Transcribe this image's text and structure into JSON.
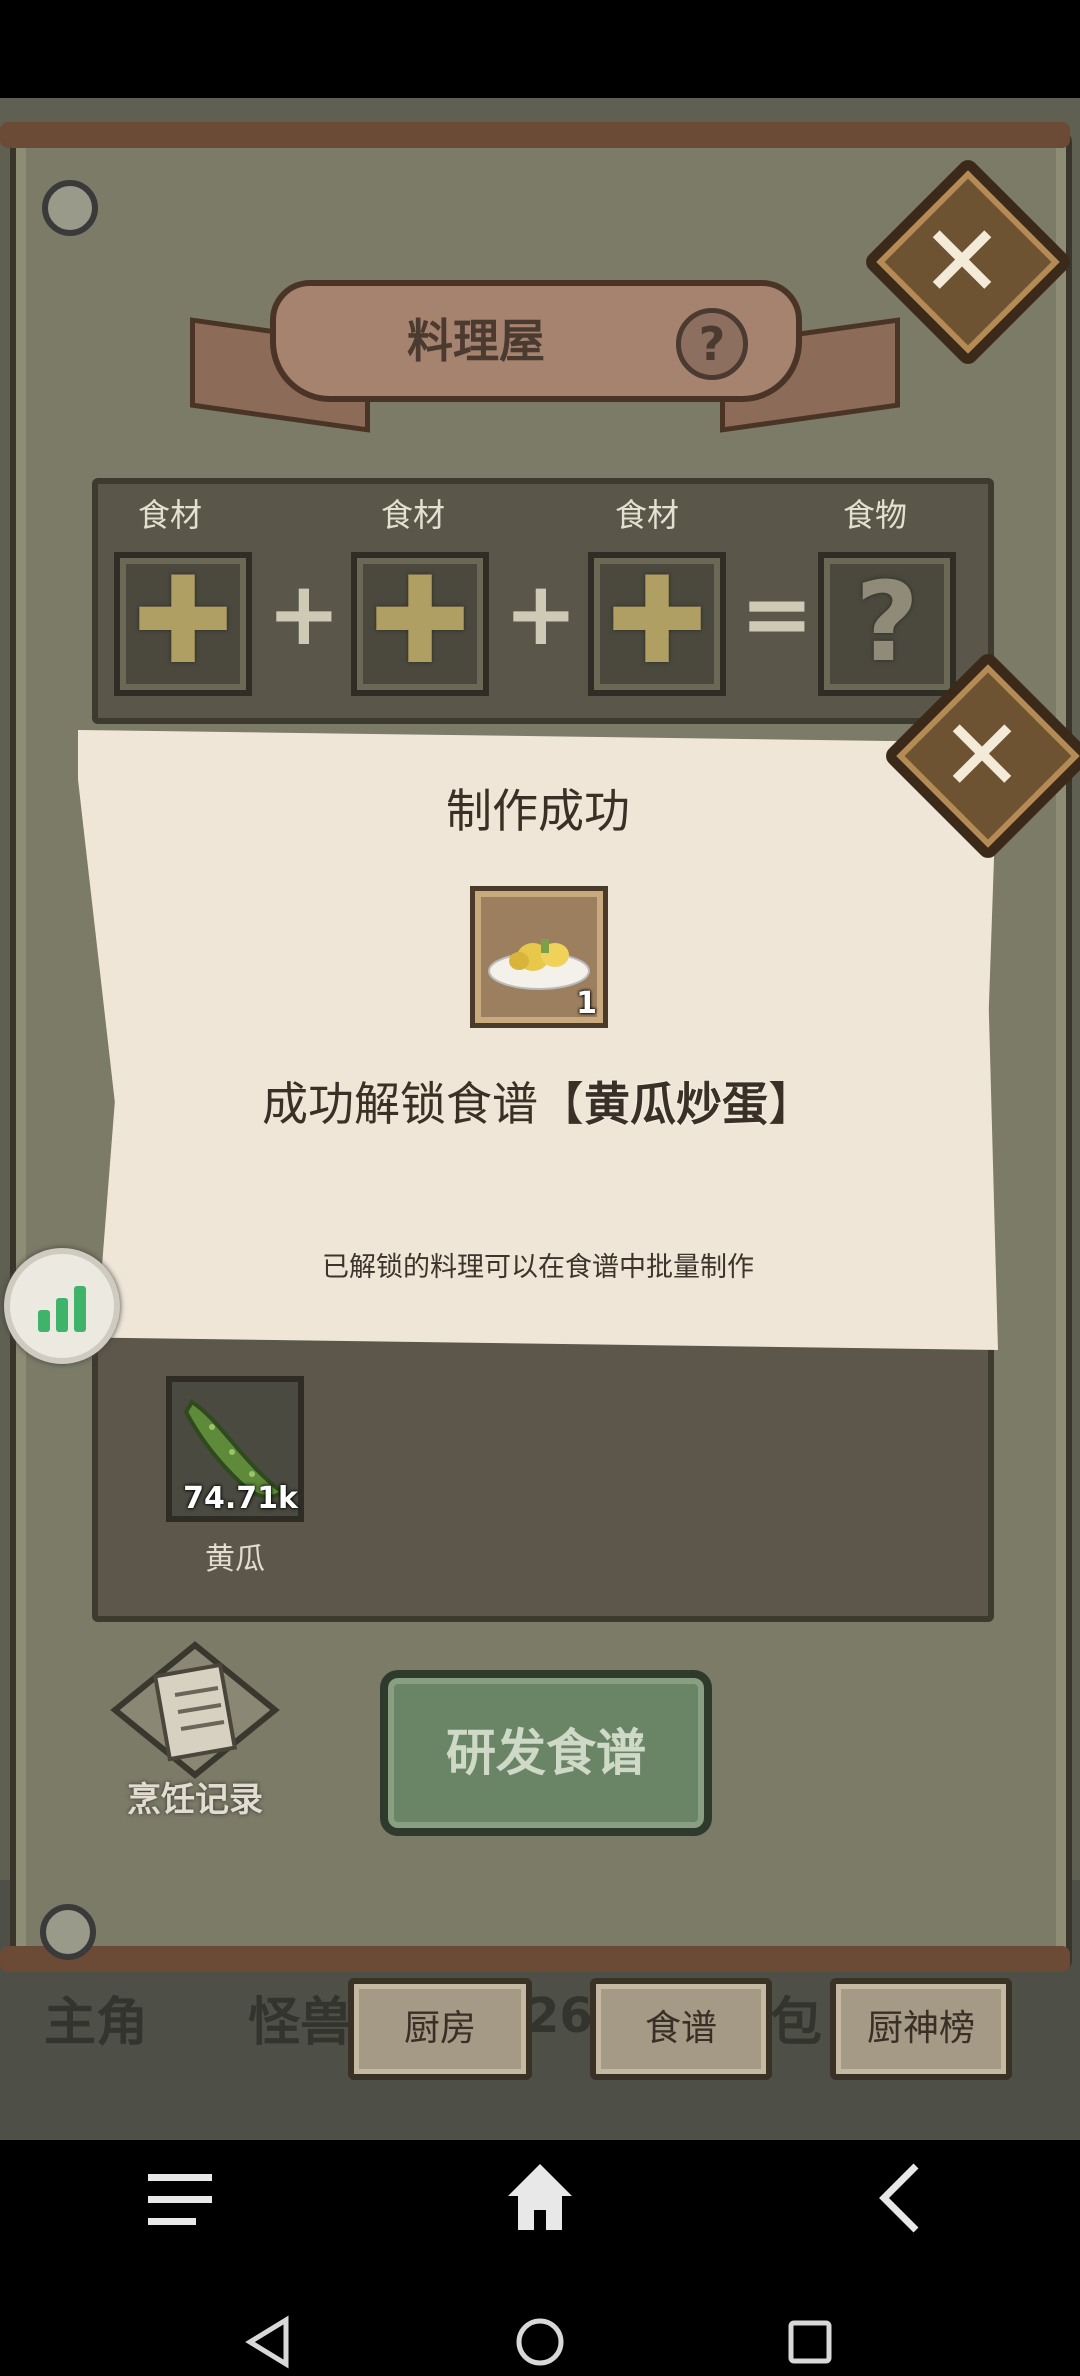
{
  "game": {
    "title": "料理屋",
    "slots": [
      {
        "label": "食材",
        "type": "add"
      },
      {
        "label": "食材",
        "type": "add"
      },
      {
        "label": "食材",
        "type": "add"
      },
      {
        "label": "食物",
        "type": "unknown"
      }
    ],
    "operators": {
      "plus": "+",
      "equals": "="
    },
    "inventory": [
      {
        "name": "黄瓜",
        "count": "74.71k"
      }
    ],
    "research_button": "研发食谱",
    "cooking_log": "烹饪记录",
    "tabs": [
      "厨房",
      "食谱",
      "厨神榜"
    ],
    "hud": {
      "left": "主角",
      "second": "怪兽",
      "timer": "11:26:50",
      "right": "包"
    }
  },
  "dialog": {
    "title": "制作成功",
    "dish_count": "1",
    "unlock_prefix": "成功解锁食谱【",
    "unlock_dish": "黄瓜炒蛋",
    "unlock_suffix": "】",
    "hint": "已解锁的料理可以在食谱中批量制作"
  },
  "colors": {
    "accent_green": "#6a8466",
    "parchment": "#efe6d8",
    "frame": "#3b2a19"
  }
}
